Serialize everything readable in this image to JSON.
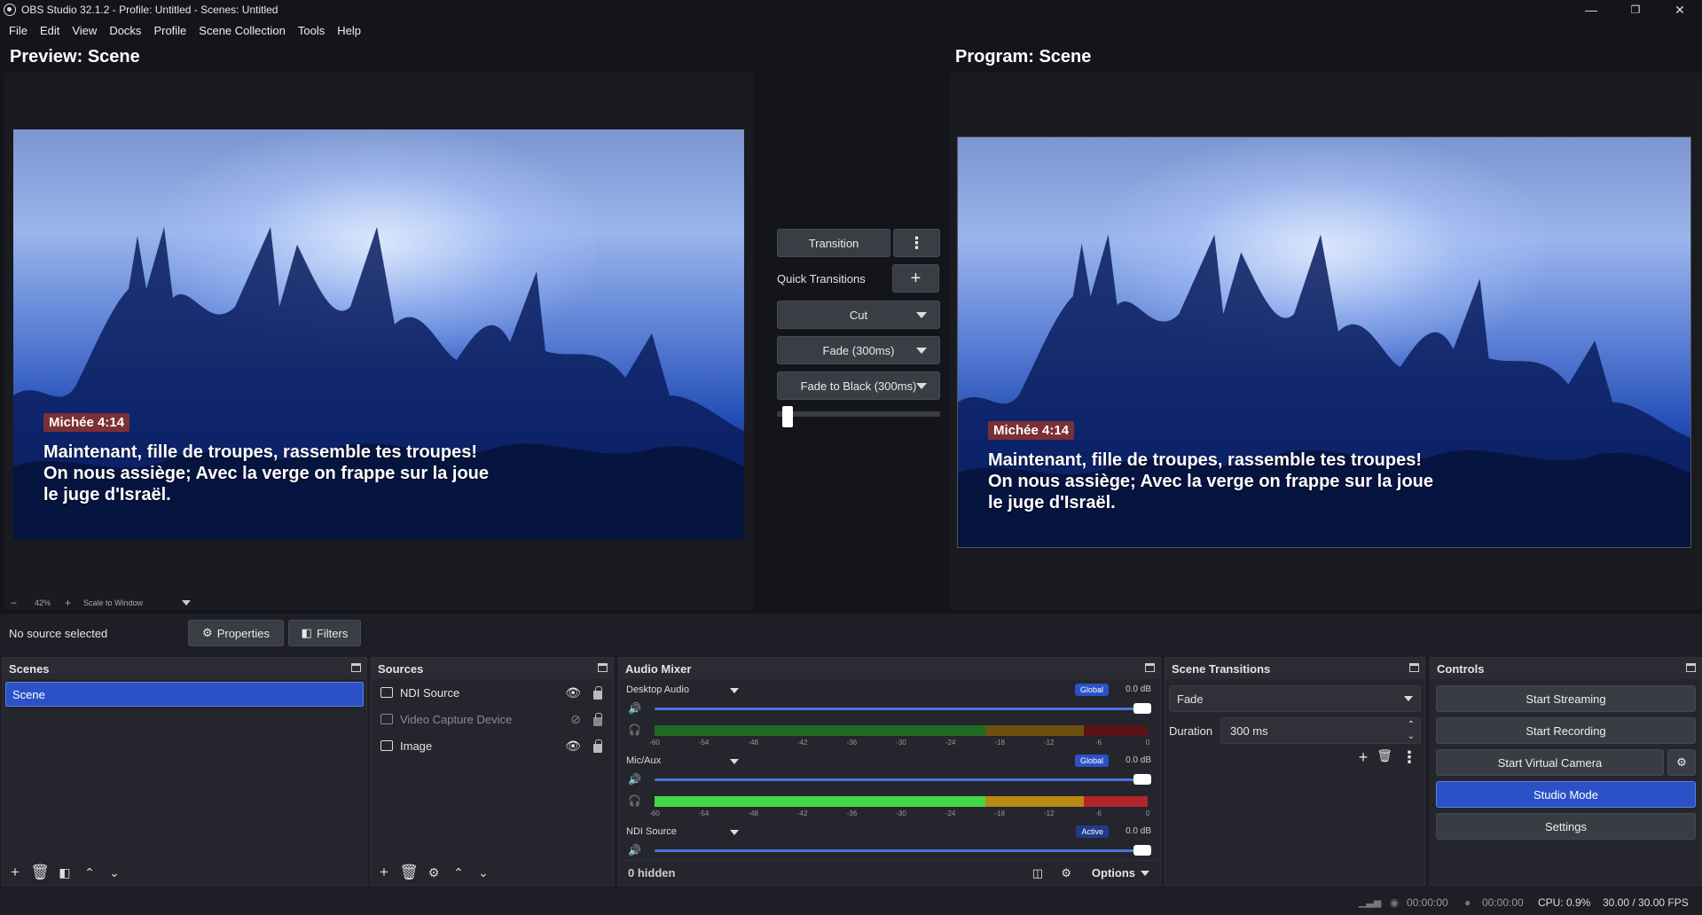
{
  "window": {
    "title": "OBS Studio 32.1.2 - Profile: Untitled - Scenes: Untitled",
    "minimize": "—",
    "maximize": "❐",
    "close": "✕"
  },
  "menu": [
    "File",
    "Edit",
    "View",
    "Docks",
    "Profile",
    "Scene Collection",
    "Tools",
    "Help"
  ],
  "preview": {
    "title": "Preview: Scene",
    "ref": "Michée 4:14",
    "verse": "Maintenant, fille de troupes, rassemble tes troupes! On nous assiège; Avec la verge on frappe sur la joue le juge d'Israël."
  },
  "program": {
    "title": "Program: Scene",
    "ref": "Michée 4:14",
    "verse": "Maintenant, fille de troupes, rassemble tes troupes! On nous assiège; Avec la verge on frappe sur la joue le juge d'Israël."
  },
  "zoom": {
    "minus": "−",
    "value": "42%",
    "plus": "+",
    "mode": "Scale to Window"
  },
  "transition_panel": {
    "transition_label": "Transition",
    "quick_label": "Quick Transitions",
    "items": [
      "Cut",
      "Fade (300ms)",
      "Fade to Black (300ms)"
    ],
    "tbar_position": 0.03
  },
  "status": {
    "selection": "No source selected",
    "properties": "Properties",
    "filters": "Filters"
  },
  "scenes": {
    "title": "Scenes",
    "items": [
      "Scene"
    ]
  },
  "sources": {
    "title": "Sources",
    "items": [
      {
        "name": "NDI Source",
        "visible": true
      },
      {
        "name": "Video Capture Device",
        "visible": false
      },
      {
        "name": "Image",
        "visible": true
      }
    ]
  },
  "mixer": {
    "title": "Audio Mixer",
    "channels": [
      {
        "name": "Desktop Audio",
        "badge": "Global",
        "db": "0.0 dB"
      },
      {
        "name": "Mic/Aux",
        "badge": "Global",
        "db": "0.0 dB"
      },
      {
        "name": "NDI Source",
        "badge": "Active",
        "db": "0.0 dB"
      }
    ],
    "scale": [
      "-60",
      "-54",
      "-48",
      "-42",
      "-36",
      "-30",
      "-24",
      "-18",
      "-12",
      "-6",
      "0"
    ],
    "hidden": "0 hidden",
    "options": "Options"
  },
  "transitions": {
    "title": "Scene Transitions",
    "selected": "Fade",
    "duration_label": "Duration",
    "duration": "300 ms"
  },
  "controls": {
    "title": "Controls",
    "start_streaming": "Start Streaming",
    "start_recording": "Start Recording",
    "start_virtual": "Start Virtual Camera",
    "studio_mode": "Studio Mode",
    "settings": "Settings"
  },
  "statusbar": {
    "stream_time": "00:00:00",
    "rec_time": "00:00:00",
    "cpu": "CPU: 0.9%",
    "fps": "30.00 / 30.00 FPS"
  },
  "colors": {
    "accent": "#2a52c6",
    "bg": "#1e1f26",
    "panel": "#24252d"
  }
}
